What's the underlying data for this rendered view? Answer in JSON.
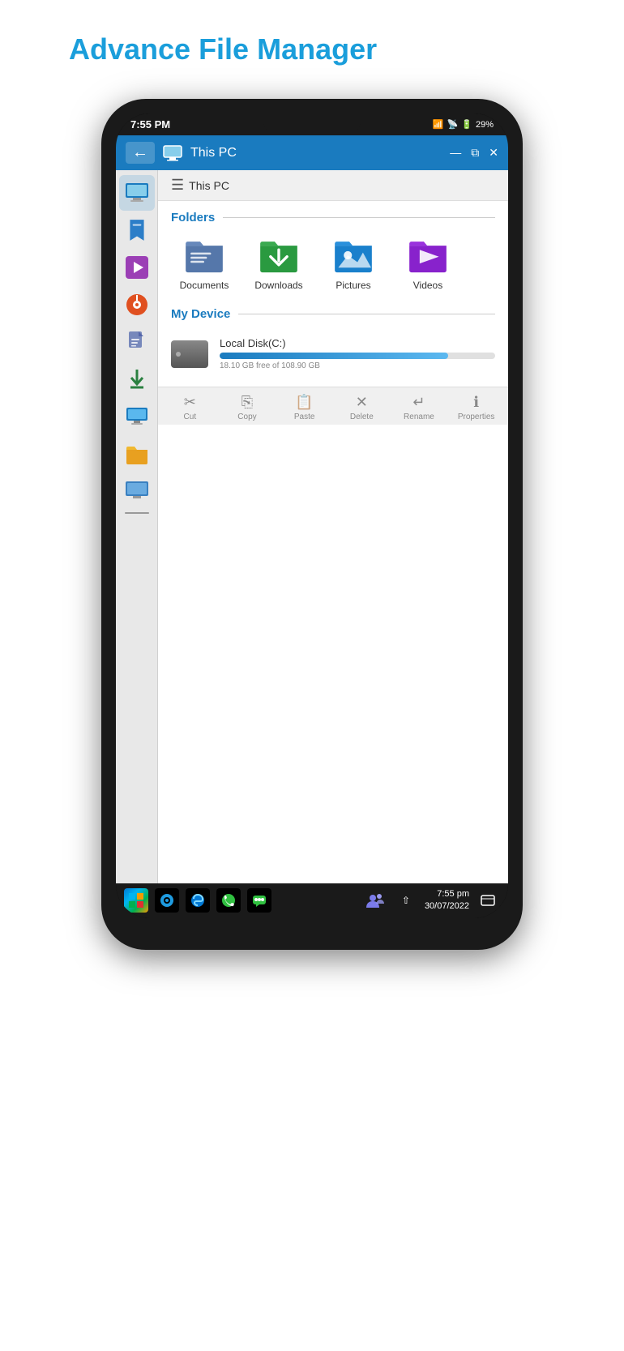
{
  "app": {
    "title": "Advance File Manager"
  },
  "statusbar": {
    "time": "7:55 PM",
    "battery": "29%"
  },
  "window": {
    "titlebar_title": "This PC",
    "breadcrumb": "This PC",
    "minimize": "—",
    "restore": "⧉",
    "close": "✕"
  },
  "sections": {
    "folders_label": "Folders",
    "device_label": "My Device"
  },
  "folders": [
    {
      "id": "documents",
      "label": "Documents",
      "color": "#5577aa"
    },
    {
      "id": "downloads",
      "label": "Downloads",
      "color": "#2a9a40"
    },
    {
      "id": "pictures",
      "label": "Pictures",
      "color": "#1a80cc"
    },
    {
      "id": "videos",
      "label": "Videos",
      "color": "#8822cc"
    }
  ],
  "disk": {
    "name": "Local Disk(C:)",
    "free_label": "18.10 GB free of 108.90 GB",
    "usage_pct": 83
  },
  "sidebar": {
    "items": [
      {
        "id": "this-pc",
        "icon": "🖥️",
        "active": true
      },
      {
        "id": "bookmark",
        "icon": "🔖"
      },
      {
        "id": "media",
        "icon": "▶️"
      },
      {
        "id": "music",
        "icon": "🎵"
      },
      {
        "id": "docs",
        "icon": "📋"
      },
      {
        "id": "downloads",
        "icon": "⬇"
      },
      {
        "id": "desktop",
        "icon": "🖼️"
      },
      {
        "id": "folder",
        "icon": "📁"
      },
      {
        "id": "network",
        "icon": "💻"
      }
    ]
  },
  "toolbar": {
    "buttons": [
      {
        "id": "cut",
        "icon": "✂",
        "label": "Cut"
      },
      {
        "id": "copy",
        "icon": "📄",
        "label": "Copy"
      },
      {
        "id": "paste",
        "icon": "📋",
        "label": "Paste"
      },
      {
        "id": "delete",
        "icon": "✕",
        "label": "Delete"
      },
      {
        "id": "rename",
        "icon": "↵",
        "label": "Rename"
      },
      {
        "id": "properties",
        "icon": "📊",
        "label": "Properties"
      }
    ]
  },
  "taskbar": {
    "clock_time": "7:55 pm",
    "clock_date": "30/07/2022"
  }
}
